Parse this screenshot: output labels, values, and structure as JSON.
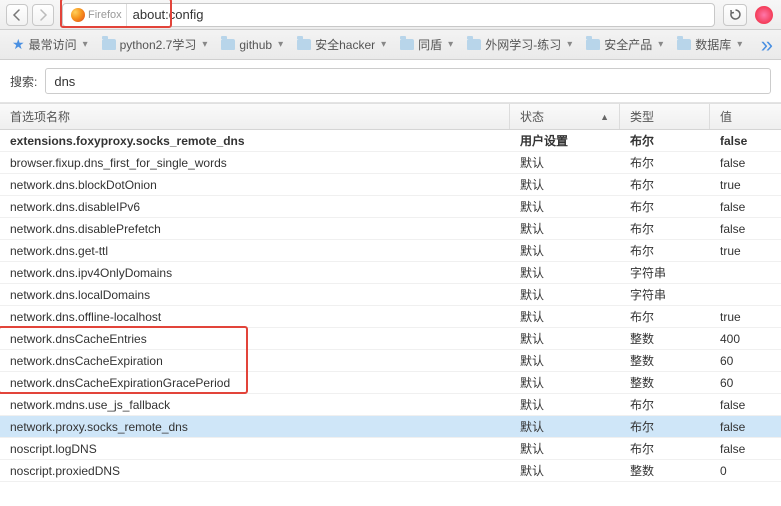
{
  "urlbar": {
    "identity_label": "Firefox",
    "url": "about:config"
  },
  "bookmarks": {
    "most_visited": "最常访问",
    "items": [
      "python2.7学习",
      "github",
      "安全hacker",
      "同盾",
      "外网学习-练习",
      "安全产品",
      "数据库"
    ]
  },
  "search": {
    "label": "搜索:",
    "value": "dns"
  },
  "columns": {
    "name": "首选项名称",
    "status": "状态",
    "type": "类型",
    "value": "值"
  },
  "rows": [
    {
      "name": "extensions.foxyproxy.socks_remote_dns",
      "status": "用户设置",
      "type": "布尔",
      "value": "false",
      "bold": true
    },
    {
      "name": "browser.fixup.dns_first_for_single_words",
      "status": "默认",
      "type": "布尔",
      "value": "false"
    },
    {
      "name": "network.dns.blockDotOnion",
      "status": "默认",
      "type": "布尔",
      "value": "true"
    },
    {
      "name": "network.dns.disableIPv6",
      "status": "默认",
      "type": "布尔",
      "value": "false"
    },
    {
      "name": "network.dns.disablePrefetch",
      "status": "默认",
      "type": "布尔",
      "value": "false"
    },
    {
      "name": "network.dns.get-ttl",
      "status": "默认",
      "type": "布尔",
      "value": "true"
    },
    {
      "name": "network.dns.ipv4OnlyDomains",
      "status": "默认",
      "type": "字符串",
      "value": ""
    },
    {
      "name": "network.dns.localDomains",
      "status": "默认",
      "type": "字符串",
      "value": ""
    },
    {
      "name": "network.dns.offline-localhost",
      "status": "默认",
      "type": "布尔",
      "value": "true"
    },
    {
      "name": "network.dnsCacheEntries",
      "status": "默认",
      "type": "整数",
      "value": "400"
    },
    {
      "name": "network.dnsCacheExpiration",
      "status": "默认",
      "type": "整数",
      "value": "60"
    },
    {
      "name": "network.dnsCacheExpirationGracePeriod",
      "status": "默认",
      "type": "整数",
      "value": "60"
    },
    {
      "name": "network.mdns.use_js_fallback",
      "status": "默认",
      "type": "布尔",
      "value": "false"
    },
    {
      "name": "network.proxy.socks_remote_dns",
      "status": "默认",
      "type": "布尔",
      "value": "false",
      "selected": true
    },
    {
      "name": "noscript.logDNS",
      "status": "默认",
      "type": "布尔",
      "value": "false"
    },
    {
      "name": "noscript.proxiedDNS",
      "status": "默认",
      "type": "整数",
      "value": "0"
    }
  ],
  "highlight_red_rows": {
    "start": 9,
    "end": 11
  }
}
